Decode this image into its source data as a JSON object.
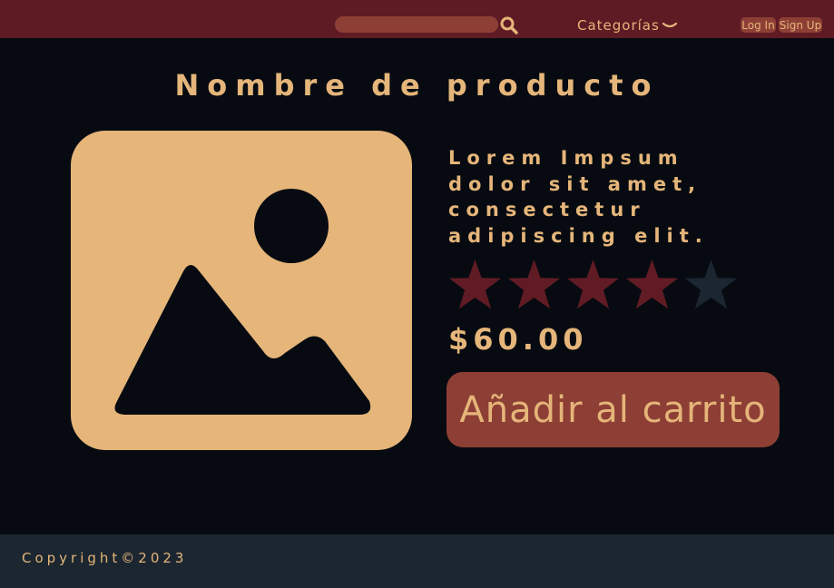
{
  "header": {
    "search": {
      "placeholder": "",
      "value": ""
    },
    "categories_label": "Categorías",
    "login_label": "Log In",
    "signup_label": "Sign Up"
  },
  "product": {
    "title": "Nombre de producto",
    "description_lines": [
      "Lorem Impsum",
      "dolor sit amet,",
      "consectetur",
      "adipiscing elit."
    ],
    "rating": {
      "value": 4,
      "max": 5
    },
    "price": "$60.00",
    "add_to_cart_label": "Añadir al carrito"
  },
  "footer": {
    "copyright": "Copyright©2023"
  },
  "colors": {
    "topbar": "#5e1b24",
    "background": "#070b11",
    "accent_text": "#e5b57a",
    "button": "#8e3f35",
    "star_filled": "#611b24",
    "star_empty": "#1b2631",
    "footer": "#1b2631"
  },
  "icons": {
    "search": "magnifier-icon",
    "categories": "chevron-down-icon",
    "product_image": "image-placeholder-icon"
  }
}
